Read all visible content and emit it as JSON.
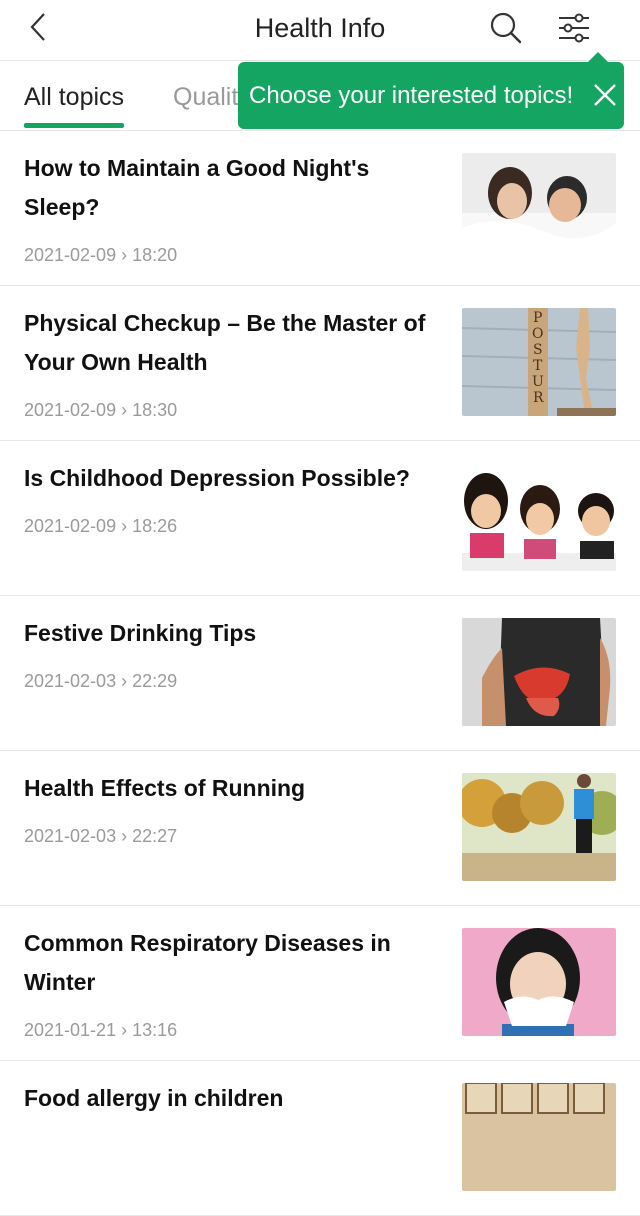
{
  "header": {
    "title": "Health Info",
    "back_icon": "chevron-left-icon",
    "search_icon": "search-icon",
    "filter_icon": "filter-sliders-icon"
  },
  "tabs": [
    {
      "label": "All topics",
      "active": true
    },
    {
      "label": "Qualit",
      "active": false
    }
  ],
  "tooltip": {
    "text": "Choose your interested topics!",
    "close_icon": "close-icon"
  },
  "accent_color": "#13a561",
  "articles": [
    {
      "title": "How to Maintain a Good Night's Sleep?",
      "date": "2021-02-09",
      "time": "18:20",
      "image": "sleeping-couple-image"
    },
    {
      "title": "Physical Checkup – Be the Master of Your Own Health",
      "date": "2021-02-09",
      "time": "18:30",
      "image": "posture-blocks-image"
    },
    {
      "title": "Is Childhood Depression Possible?",
      "date": "2021-02-09",
      "time": "18:26",
      "image": "three-children-image"
    },
    {
      "title": "Festive Drinking Tips",
      "date": "2021-02-03",
      "time": "22:29",
      "image": "liver-illustration-image"
    },
    {
      "title": "Health Effects of Running",
      "date": "2021-02-03",
      "time": "22:27",
      "image": "woman-running-image"
    },
    {
      "title": "Common Respiratory Diseases in Winter",
      "date": "2021-01-21",
      "time": "13:16",
      "image": "woman-sneezing-image"
    },
    {
      "title": "Food allergy in children",
      "date": "",
      "time": "",
      "image": "alphabet-blocks-image"
    }
  ]
}
